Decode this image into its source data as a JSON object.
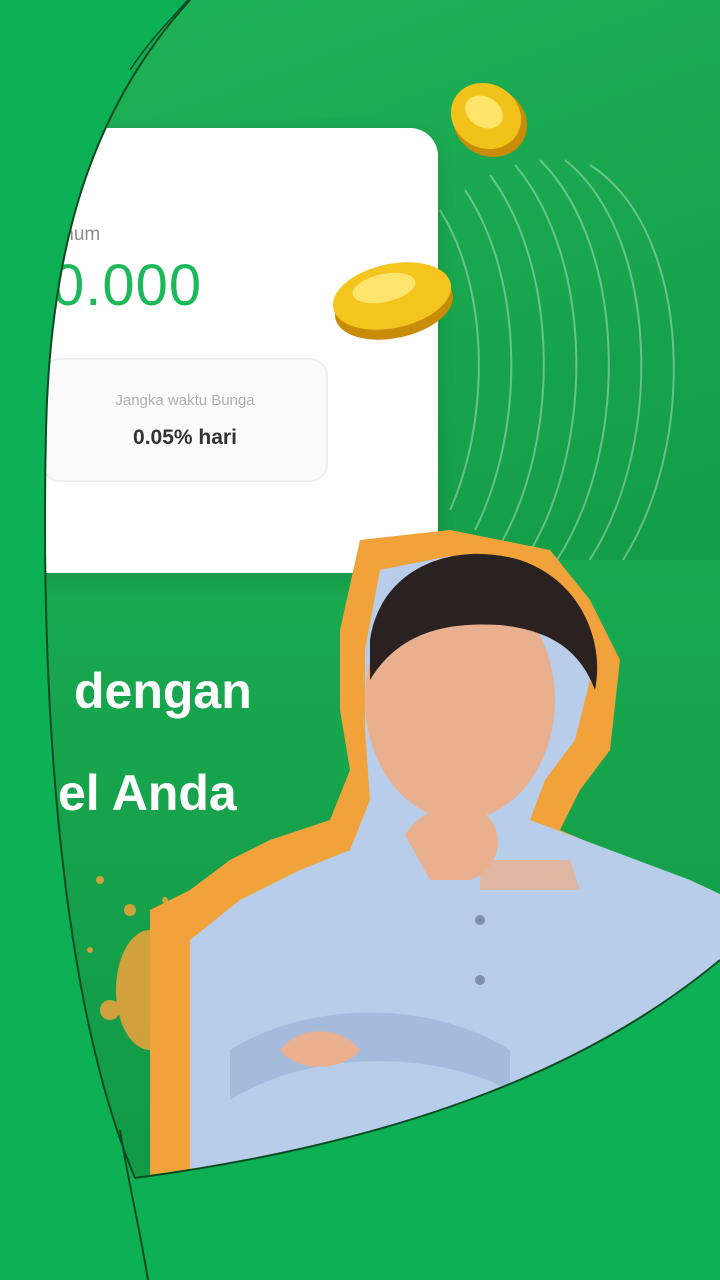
{
  "promo": {
    "card": {
      "caption": "mum",
      "amount": "0.000",
      "term_label": "Jangka waktu Bunga",
      "term_value": "0.05% hari"
    },
    "headline_line_1": "dengan",
    "headline_line_2": "el Anda"
  },
  "colors": {
    "page_green": "#0db055",
    "promo_green": "#14a84c",
    "amount_green": "#1db85a",
    "accent_orange": "#f2a23a",
    "shirt_blue": "#b8cdea"
  },
  "icons": [
    "coin-icon",
    "coin-icon"
  ]
}
